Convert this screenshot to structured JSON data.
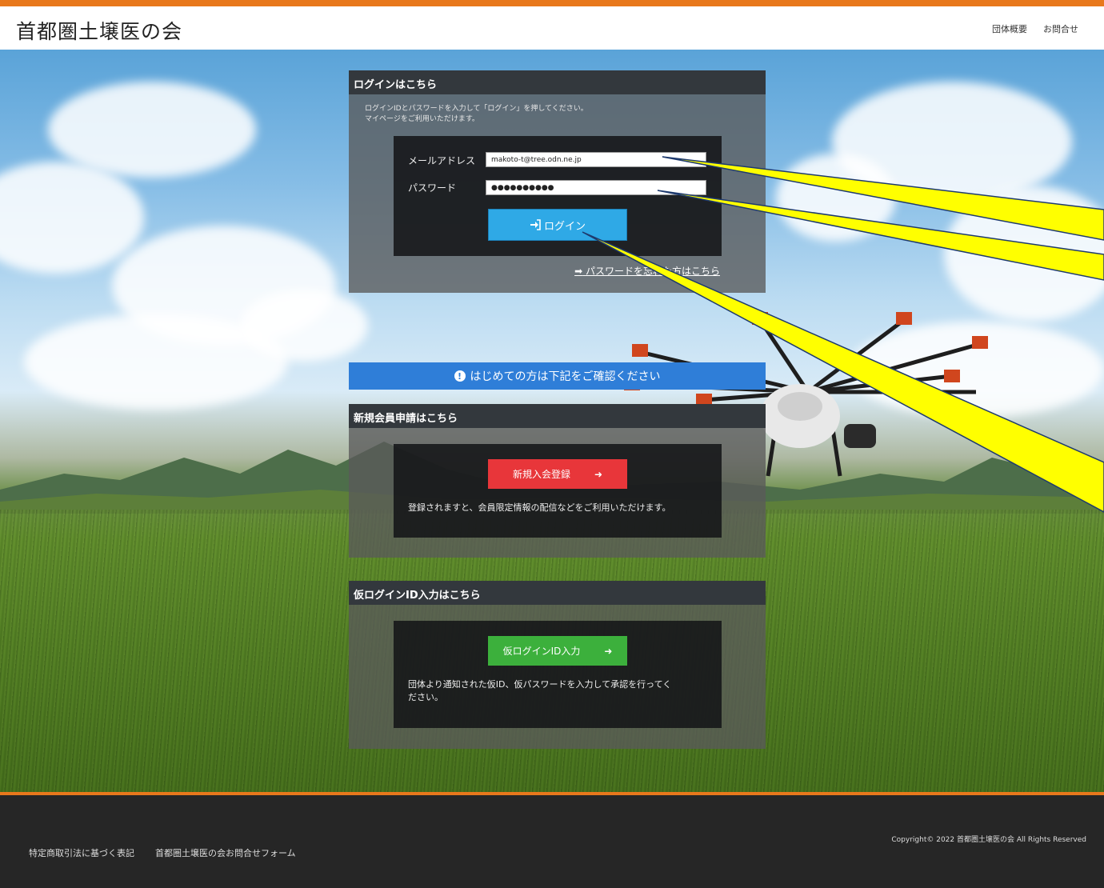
{
  "header": {
    "site_title": "首都圏土壌医の会",
    "nav": [
      "団体概要",
      "お問合せ"
    ]
  },
  "login": {
    "heading": "ログインはこちら",
    "desc_line1": "ログインIDとパスワードを入力して「ログイン」を押してください。",
    "desc_line2": "マイページをご利用いただけます。",
    "email_label": "メールアドレス",
    "email_value": "makoto-t@tree.odn.ne.jp",
    "password_label": "パスワード",
    "password_value": "●●●●●●●●●●",
    "login_button": "ログイン",
    "forgot_link": "パスワードを忘れた方はこちら"
  },
  "notice": {
    "text": "はじめての方は下記をご確認ください"
  },
  "register": {
    "heading": "新規会員申請はこちら",
    "button": "新規入会登録",
    "text": "登録されますと、会員限定情報の配信などをご利用いただけます。"
  },
  "temp_login": {
    "heading": "仮ログインID入力はこちら",
    "button": "仮ログインID入力",
    "text_line1": "団体より通知された仮ID、仮パスワードを入力して承認を行ってく",
    "text_line2": "ださい。"
  },
  "footer": {
    "links": [
      "特定商取引法に基づく表記",
      "首都圏土壌医の会お問合せフォーム"
    ],
    "copyright": "Copyright©  2022  首都圏土壌医の会  All Rights Reserved"
  },
  "colors": {
    "accent_orange": "#e8781c",
    "login_blue": "#2fa9e6",
    "notice_blue": "#2f7ed8",
    "register_red": "#e8363a",
    "temp_green": "#3cb03c",
    "callout_yellow": "#ffff00"
  },
  "icons": {
    "login": "login-icon",
    "forgot_arrow": "arrow-right-icon",
    "notice": "info-icon",
    "button_arrow": "arrow-right-icon"
  }
}
